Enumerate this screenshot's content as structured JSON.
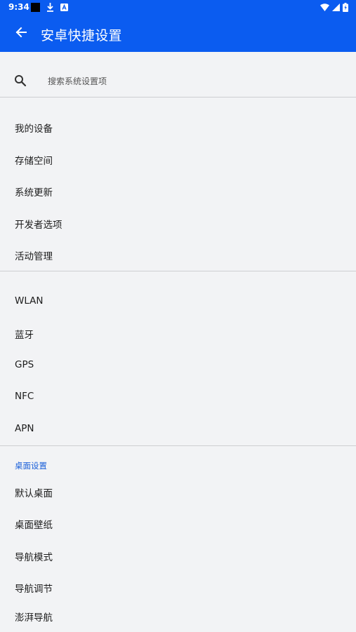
{
  "status_bar": {
    "time": "9:34",
    "icons": [
      "black-square-icon",
      "download-icon",
      "text-a-icon",
      "wifi-icon",
      "cell-signal-icon",
      "battery-charging-icon"
    ]
  },
  "app_bar": {
    "title": "安卓快捷设置",
    "back_icon": "arrow-left-icon",
    "color": "#0b5cf0"
  },
  "search": {
    "placeholder": "搜索系统设置项",
    "value": ""
  },
  "group_device": {
    "items": [
      {
        "label": "我的设备"
      },
      {
        "label": "存储空间"
      },
      {
        "label": "系统更新"
      },
      {
        "label": "开发者选项"
      },
      {
        "label": "活动管理"
      }
    ]
  },
  "group_network": {
    "items": [
      {
        "label": "WLAN"
      },
      {
        "label": "蓝牙"
      },
      {
        "label": "GPS"
      },
      {
        "label": "NFC"
      },
      {
        "label": "APN"
      }
    ]
  },
  "group_desktop": {
    "header": "桌面设置",
    "header_color": "#1a5fd9",
    "items": [
      {
        "label": "默认桌面"
      },
      {
        "label": "桌面壁纸"
      },
      {
        "label": "导航模式"
      },
      {
        "label": "导航调节"
      },
      {
        "label": "澎湃导航"
      }
    ]
  }
}
